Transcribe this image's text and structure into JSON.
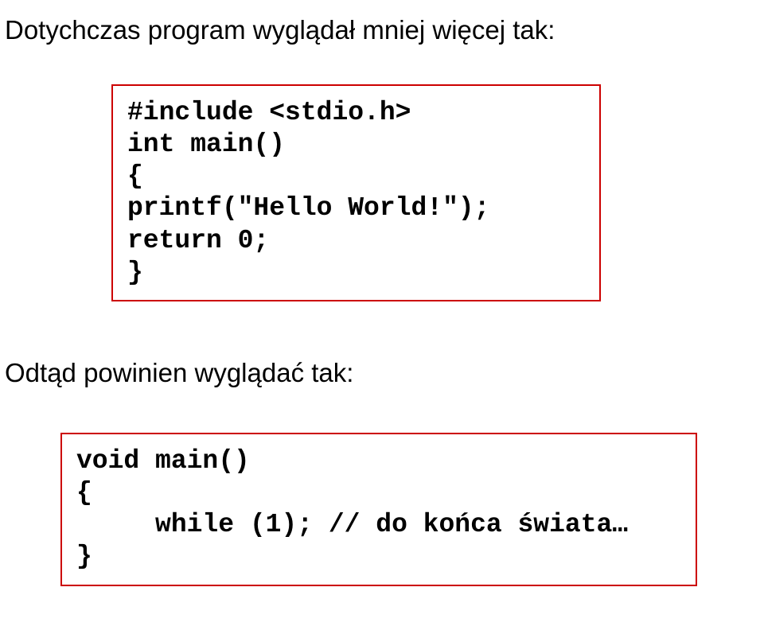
{
  "intro": "Dotychczas program wyglądał mniej więcej tak:",
  "code1": "#include <stdio.h>\nint main()\n{\nprintf(\"Hello World!\");\nreturn 0;\n}",
  "sub": "Odtąd powinien wyglądać tak:",
  "code2": "void main()\n{\n     while (1); // do końca świata…\n}"
}
